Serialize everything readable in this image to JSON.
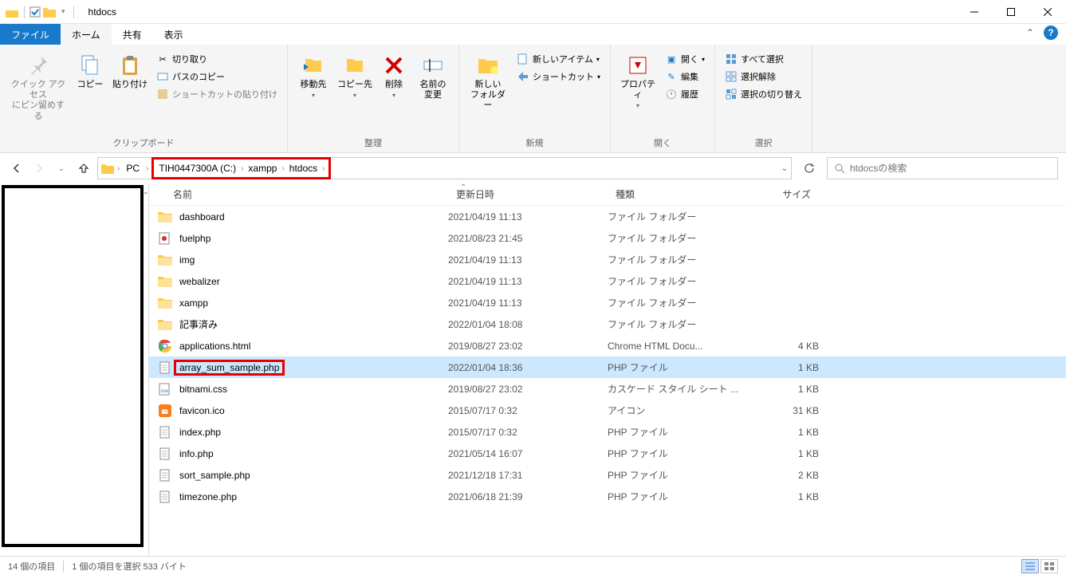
{
  "window": {
    "title": "htdocs"
  },
  "tabs": {
    "file": "ファイル",
    "home": "ホーム",
    "share": "共有",
    "view": "表示"
  },
  "ribbon": {
    "clipboard": {
      "label": "クリップボード",
      "pin": "クイック アクセス\nにピン留めする",
      "copy": "コピー",
      "paste": "貼り付け",
      "cut": "切り取り",
      "copypath": "パスのコピー",
      "pasteshortcut": "ショートカットの貼り付け"
    },
    "organize": {
      "label": "整理",
      "moveto": "移動先",
      "copyto": "コピー先",
      "delete": "削除",
      "rename": "名前の\n変更"
    },
    "new": {
      "label": "新規",
      "newfolder": "新しい\nフォルダー",
      "newitem": "新しいアイテム",
      "shortcut": "ショートカット"
    },
    "open": {
      "label": "開く",
      "properties": "プロパティ",
      "open": "開く",
      "edit": "編集",
      "history": "履歴"
    },
    "select": {
      "label": "選択",
      "selectall": "すべて選択",
      "selectnone": "選択解除",
      "invert": "選択の切り替え"
    }
  },
  "breadcrumb": {
    "pc": "PC",
    "drive": "TIH0447300A (C:)",
    "folder1": "xampp",
    "folder2": "htdocs"
  },
  "search": {
    "placeholder": "htdocsの検索"
  },
  "columns": {
    "name": "名前",
    "date": "更新日時",
    "type": "種類",
    "size": "サイズ"
  },
  "files": [
    {
      "icon": "folder",
      "name": "dashboard",
      "date": "2021/04/19 11:13",
      "type": "ファイル フォルダー",
      "size": ""
    },
    {
      "icon": "fuel",
      "name": "fuelphp",
      "date": "2021/08/23 21:45",
      "type": "ファイル フォルダー",
      "size": ""
    },
    {
      "icon": "folder",
      "name": "img",
      "date": "2021/04/19 11:13",
      "type": "ファイル フォルダー",
      "size": ""
    },
    {
      "icon": "folder",
      "name": "webalizer",
      "date": "2021/04/19 11:13",
      "type": "ファイル フォルダー",
      "size": ""
    },
    {
      "icon": "folder",
      "name": "xampp",
      "date": "2021/04/19 11:13",
      "type": "ファイル フォルダー",
      "size": ""
    },
    {
      "icon": "folder",
      "name": "記事済み",
      "date": "2022/01/04 18:08",
      "type": "ファイル フォルダー",
      "size": ""
    },
    {
      "icon": "chrome",
      "name": "applications.html",
      "date": "2019/08/27 23:02",
      "type": "Chrome HTML Docu...",
      "size": "4 KB"
    },
    {
      "icon": "file",
      "name": "array_sum_sample.php",
      "date": "2022/01/04 18:36",
      "type": "PHP ファイル",
      "size": "1 KB",
      "selected": true
    },
    {
      "icon": "css",
      "name": "bitnami.css",
      "date": "2019/08/27 23:02",
      "type": "カスケード スタイル シート ...",
      "size": "1 KB"
    },
    {
      "icon": "xampp",
      "name": "favicon.ico",
      "date": "2015/07/17 0:32",
      "type": "アイコン",
      "size": "31 KB"
    },
    {
      "icon": "file",
      "name": "index.php",
      "date": "2015/07/17 0:32",
      "type": "PHP ファイル",
      "size": "1 KB"
    },
    {
      "icon": "file",
      "name": "info.php",
      "date": "2021/05/14 16:07",
      "type": "PHP ファイル",
      "size": "1 KB"
    },
    {
      "icon": "file",
      "name": "sort_sample.php",
      "date": "2021/12/18 17:31",
      "type": "PHP ファイル",
      "size": "2 KB"
    },
    {
      "icon": "file",
      "name": "timezone.php",
      "date": "2021/06/18 21:39",
      "type": "PHP ファイル",
      "size": "1 KB"
    }
  ],
  "status": {
    "count": "14 個の項目",
    "selection": "1 個の項目を選択 533 バイト"
  }
}
